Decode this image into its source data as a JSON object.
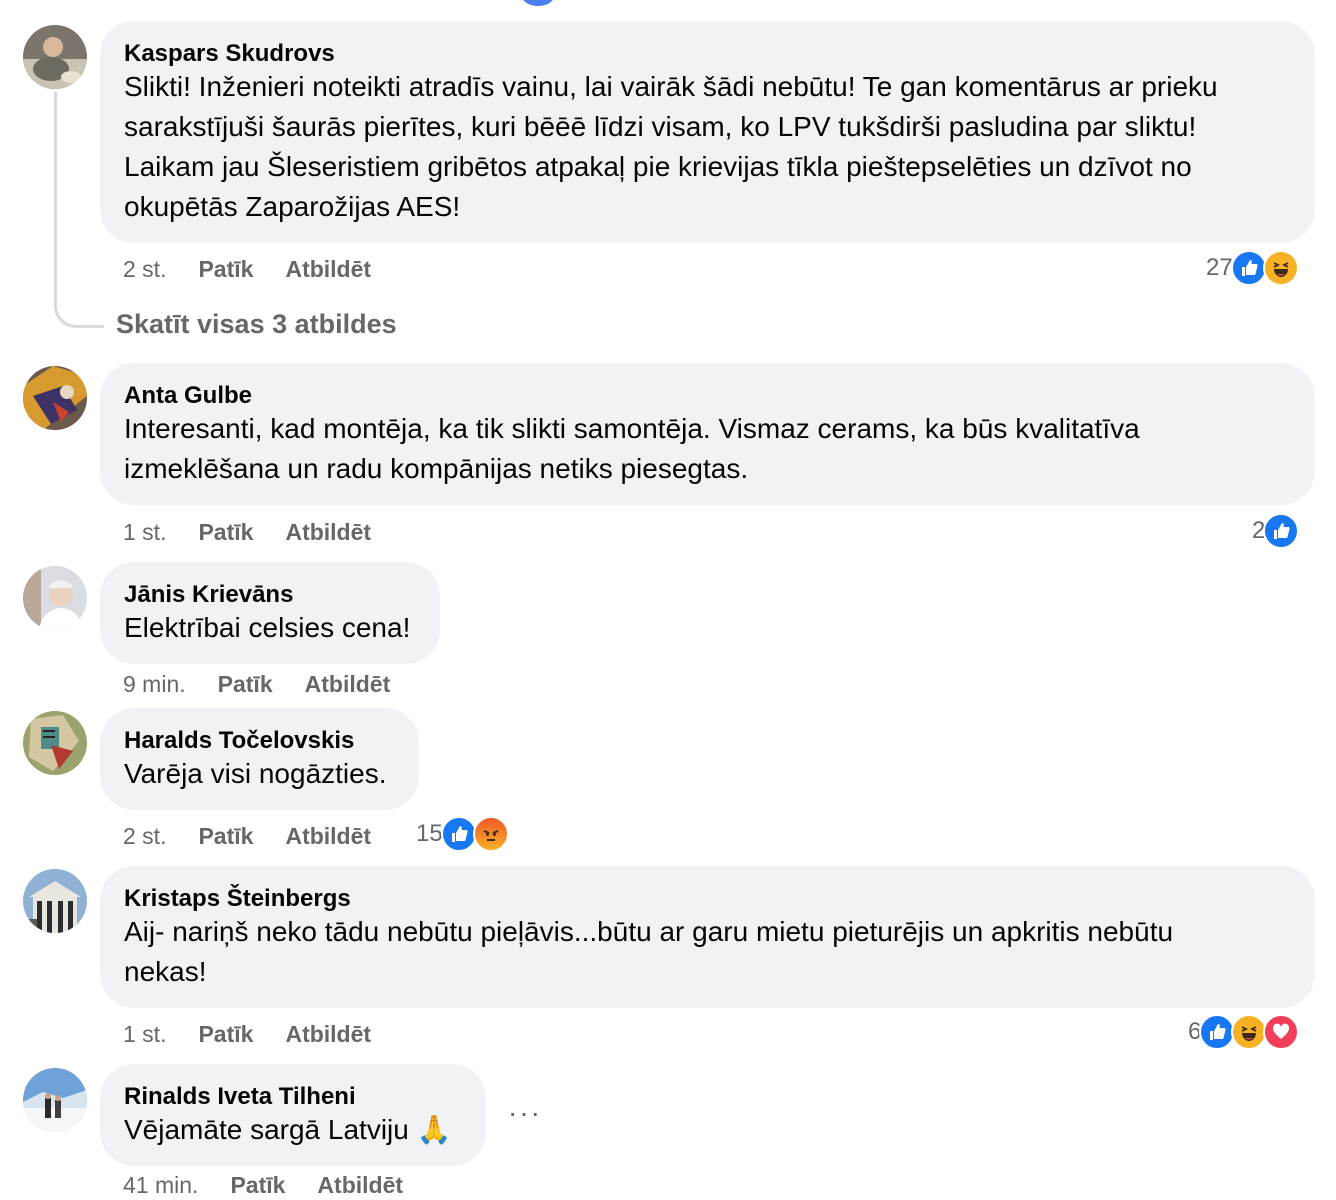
{
  "ui": {
    "like_label": "Patīk",
    "reply_label": "Atbildēt",
    "view_replies": "Skatīt visas 3 atbildes",
    "more_options": "···"
  },
  "comments": [
    {
      "author": "Kaspars Skudrovs",
      "text": "Slikti! Inženieri noteikti atradīs vainu, lai vairāk šādi nebūtu! Te gan komentārus ar prieku\nsarakstījuši šaurās pierītes, kuri bēēē līdzi visam, ko LPV tukšdirši pasludina par sliktu!\nLaikam jau Šleseristiem gribētos atpakaļ pie krievijas tīkla pieštepselēties un dzīvot no\nokupētās Zaparožijas AES!",
      "time": "2 st.",
      "reaction_count": "27",
      "reactions": [
        "like-icon",
        "haha-icon"
      ]
    },
    {
      "author": "Anta Gulbe",
      "text": "Interesanti, kad montēja, ka tik slikti samontēja. Vismaz cerams, ka būs kvalitatīva\nizmeklēšana un radu kompānijas netiks piesegtas.",
      "time": "1 st.",
      "reaction_count": "2",
      "reactions": [
        "like-icon"
      ]
    },
    {
      "author": "Jānis Krievāns",
      "text": "Elektrībai celsies cena!",
      "time": "9 min."
    },
    {
      "author": "Haralds Točelovskis",
      "text": "Varēja visi nogāzties.",
      "time": "2 st.",
      "reaction_count": "15",
      "reactions": [
        "like-icon",
        "angry-icon"
      ]
    },
    {
      "author": "Kristaps Šteinbergs",
      "text": "Aij- nariņš neko tādu nebūtu pieļāvis...būtu ar garu mietu pieturējis un apkritis nebūtu\nnekas!",
      "time": "1 st.",
      "reaction_count": "6",
      "reactions": [
        "like-icon",
        "haha-icon",
        "love-icon"
      ]
    },
    {
      "author": "Rinalds Iveta Tilheni",
      "text": "Vējamāte sargā Latviju 🙏",
      "time": "41 min."
    }
  ],
  "colors": {
    "bubble": "#f0f2f5",
    "secondary_text": "#65676b",
    "like_blue": "#1877f2",
    "haha_yellow": "#f7b125",
    "angry_orange": "#e9710f",
    "love_red": "#f33e58"
  }
}
